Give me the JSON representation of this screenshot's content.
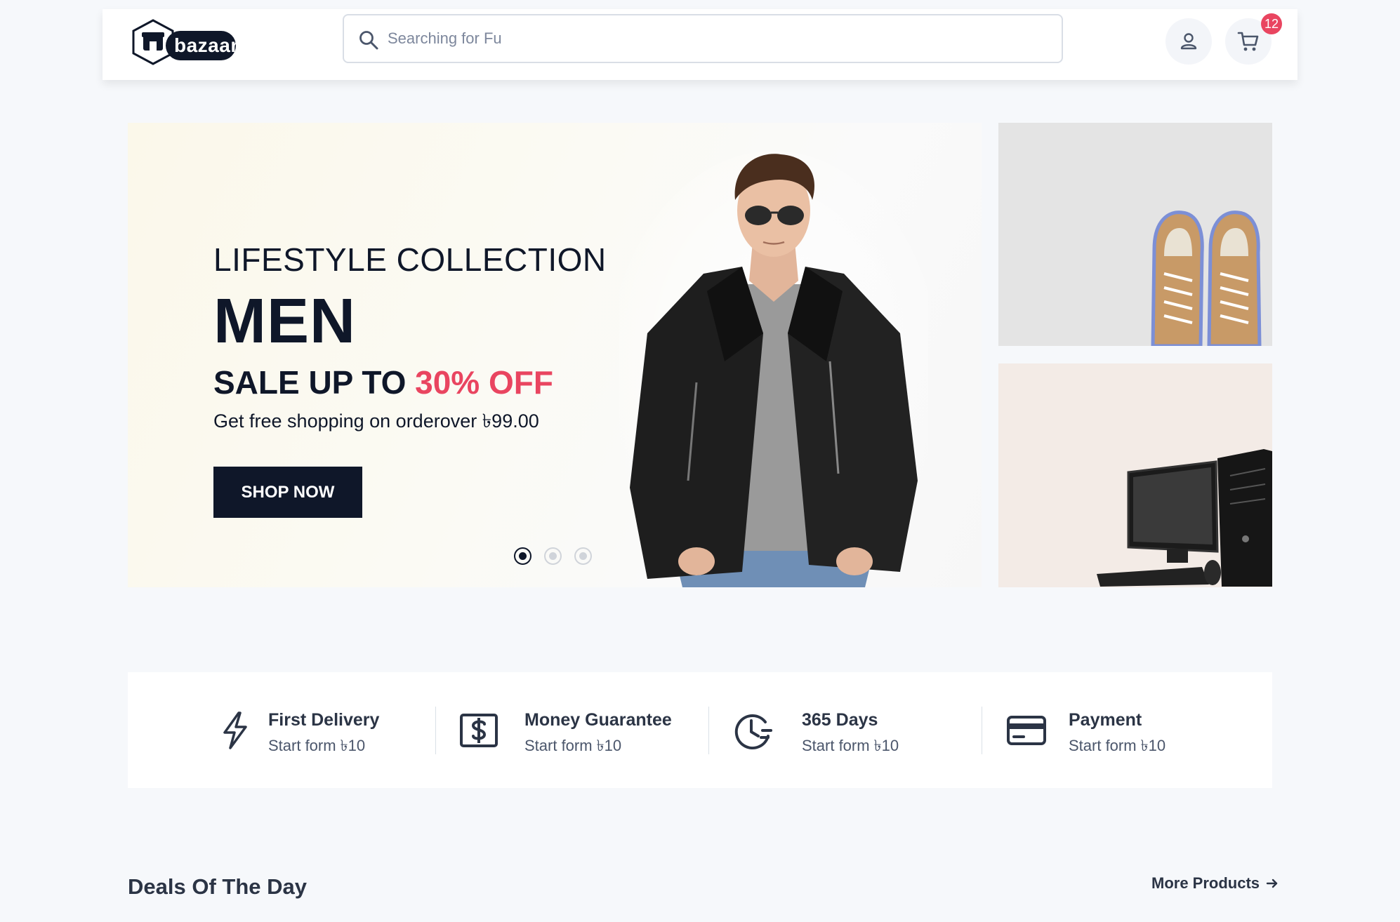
{
  "header": {
    "logo_text": "bazaar",
    "search": {
      "placeholder": "Searching for Fu"
    },
    "cart_count": "12"
  },
  "hero": {
    "subtitle": "LIFESTYLE COLLECTION",
    "title": "MEN",
    "sale_prefix": "SALE UP TO ",
    "sale_highlight": "30% OFF",
    "description": "Get free shopping on orderover ৳99.00",
    "button_label": "SHOP NOW",
    "slides": 3,
    "active_slide": 1,
    "colors": {
      "accent": "#e94560",
      "dark": "#0f1729"
    }
  },
  "side_banners": [
    {
      "image": "sneakers"
    },
    {
      "image": "desktop-computer"
    }
  ],
  "services": [
    {
      "icon": "lightning-icon",
      "title": "First Delivery",
      "subtitle": "Start form ৳10"
    },
    {
      "icon": "dollar-icon",
      "title": "Money Guarantee",
      "subtitle": "Start form ৳10"
    },
    {
      "icon": "clock-icon",
      "title": "365 Days",
      "subtitle": "Start form ৳10"
    },
    {
      "icon": "credit-card-icon",
      "title": "Payment",
      "subtitle": "Start form ৳10"
    }
  ],
  "deals": {
    "title": "Deals Of The Day",
    "more_label": "More Products"
  }
}
